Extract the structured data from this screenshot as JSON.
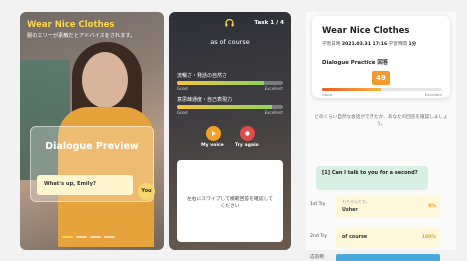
{
  "preview": {
    "title": "Wear Nice Clothes",
    "subtitle": "服のエリーが素敵だとアドバイスをされます。",
    "card_title": "Dialogue Preview",
    "speech": "What's up, Emily?",
    "you_badge": "You"
  },
  "practice": {
    "task": "Task 1 / 4",
    "phrase": "as of course",
    "meters": [
      {
        "label": "流暢さ・発話の自然さ",
        "level": 0.82,
        "low": "Good",
        "high": "Excellent"
      },
      {
        "label": "意思疎通度・自己表現力",
        "level": 0.9,
        "low": "Good",
        "high": "Excellent"
      }
    ],
    "my_voice": "My voice",
    "try_again": "Try again",
    "swipe_text": "左右にスワイプして模範回答を確認してください"
  },
  "result": {
    "title": "Wear Nice Clothes",
    "date_label": "学習日時",
    "date_value": "2021.03.31 17:16",
    "time_label": "学習時間",
    "time_value": "1分",
    "practice_label": "Dialogue Practice 回答",
    "score": "49",
    "score_level": 0.49,
    "low": "Good",
    "high": "Excellent",
    "note": "どのくらい自然な会話ができたか、あなたの回答を確認しましょう。",
    "question_num": "[1]",
    "question": "Can I talk to you for a second?",
    "tries": [
      {
        "label": "1st Try",
        "hint": "もちろんです。",
        "answer": "Usher",
        "pct": "8%",
        "pct_color": "#f29a2e"
      },
      {
        "label": "2nd Try",
        "hint": "",
        "answer": "of course",
        "pct": "100%",
        "pct_color": "#f29a2e"
      },
      {
        "label": "応答例",
        "hint": "",
        "answer": "",
        "pct": "",
        "pct_color": "#4aa7d9"
      }
    ]
  }
}
